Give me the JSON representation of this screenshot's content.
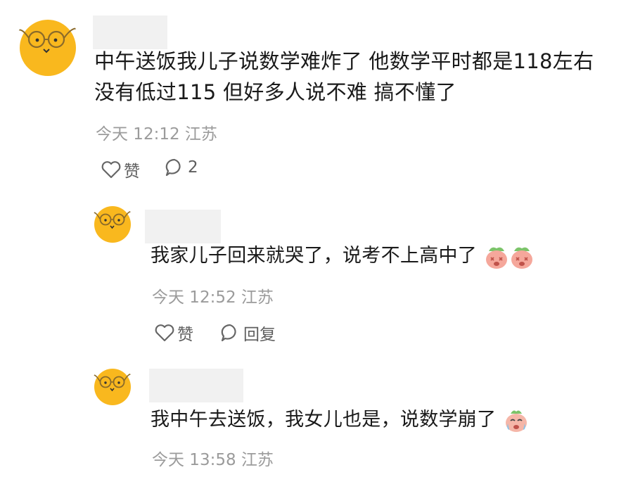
{
  "comments": [
    {
      "text_line1": "中午送饭我儿子说数学难炸了 他数学平时都是118左右",
      "text_line2": "没有低过115 但好多人说不难 搞不懂了",
      "time": "今天 12:12",
      "location": "江苏",
      "like_label": "赞",
      "reply_count": "2"
    },
    {
      "text": "我家儿子回来就哭了，说考不上高中了",
      "emojis": [
        "crying-peach-emoji",
        "crying-peach-emoji"
      ],
      "time": "今天 12:52",
      "location": "江苏",
      "like_label": "赞",
      "reply_label": "回复"
    },
    {
      "text": "我中午去送饭，我女儿也是，说数学崩了",
      "emojis": [
        "sobbing-face-emoji"
      ],
      "time": "今天 13:58",
      "location": "江苏"
    }
  ],
  "colors": {
    "avatar_yellow": "#f9b81e",
    "meta_gray": "#9b9b9b",
    "name_placeholder": "#f1f1f1"
  }
}
